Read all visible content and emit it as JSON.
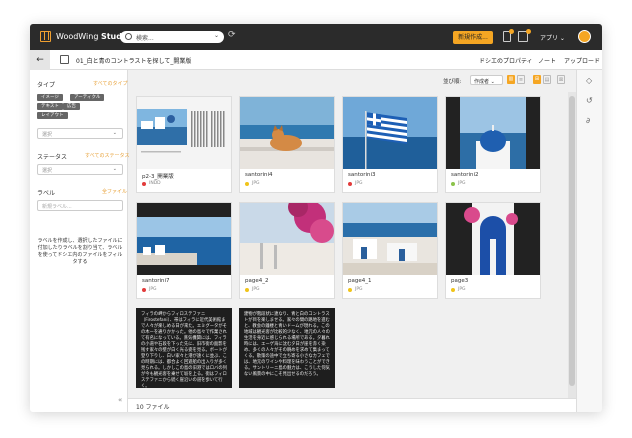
{
  "header": {
    "brand_name": "WoodWing",
    "brand_product": "Studio",
    "search_placeholder": "検索...",
    "new_button": "新規作成...",
    "apps_label": "アプリ ⌄",
    "refresh_icon": "refresh-icon"
  },
  "breadcrumb": {
    "path": "01_白と青のコントラストを探して_開業版",
    "actions": [
      "ドシエのプロパティ",
      "ノート",
      "アップロード"
    ]
  },
  "sidebar": {
    "type_heading": "タイプ",
    "type_link": "すべてのタイプ",
    "type_tags": [
      "イメージ",
      "テキスト",
      "テキスト",
      "レイアウト"
    ],
    "type_tags_row1": [
      "イメージ",
      "アーティクル"
    ],
    "type_tags_row2": [
      "テキスト",
      "広告"
    ],
    "type_tags_row3": [
      "レイアウト"
    ],
    "type_select_placeholder": "選択",
    "status_heading": "ステータス",
    "status_link": "すべてのステータス",
    "status_select_placeholder": "選択",
    "label_heading": "ラベル",
    "label_link": "全ファイル",
    "label_input_placeholder": "新規ラベル...",
    "help_text": "ラベルを作成し、選択したファイルに付加したりラベルを割り当て、ラベルを使ってドシエ内のファイルをフィルタする"
  },
  "toolbar": {
    "sort_label": "並び順:",
    "sort_value": "作成者",
    "view_buttons": [
      "▥",
      "≡",
      "⊞",
      "▤",
      "⊠"
    ]
  },
  "files": [
    {
      "name": "p2-3_開業版",
      "type": "INDD",
      "status_color": "#e23b3b",
      "thumb": "layout"
    },
    {
      "name": "santorini4",
      "type": "JPG",
      "status_color": "#f0c419",
      "thumb": "cat"
    },
    {
      "name": "santorini3",
      "type": "JPG",
      "status_color": "#e23b3b",
      "thumb": "flag"
    },
    {
      "name": "santorini2",
      "type": "JPG",
      "status_color": "#8bc34a",
      "thumb": "dome"
    },
    {
      "name": "santorini7",
      "type": "JPG",
      "status_color": "#e23b3b",
      "thumb": "sea"
    },
    {
      "name": "page4_2",
      "type": "JPG",
      "status_color": "#f0c419",
      "thumb": "flowers"
    },
    {
      "name": "page4_1",
      "type": "JPG",
      "status_color": "#f0c419",
      "thumb": "houses"
    },
    {
      "name": "page3",
      "type": "JPG",
      "status_color": "#f0c419",
      "thumb": "door"
    }
  ],
  "text_files": [
    {
      "text": "フィラの岬からフィロステファニ（Firostefani）、帯はフィラに近代美術館まで人々が楽しめる日が来た。エミグータがその木ーを通りかかった。他の島々で作業されて有名になっている。蒸気機関には、フィラの小道や石段を下った先に、旧市街の面影を残す家々の壁が白く光る姿を見る。ボートが登り下りし、白い家々と港が遠くに並ぶ、この時期には、都合よく回遊船の出入りが多く見られる。しかしこの島の旧港ではロバの列が今も観光客を乗せて坂を上る。街はフィロステファニから続く崖沿いの道を歩いて行く。",
      "title": "フィラからの..."
    },
    {
      "text": "建物が階段状に連なり、青と白のコントラストが目を楽しませる。家々の間の路地を進むと、教会の鐘楼と青いドームが現れる。この地域は観光客が比較的少なく、地元の人々の生活を身近に感じられる場所である。夕暮れ時には、エーゲ海に沈む夕日が崖を赤く染め、多くの人々がその眺めを求めて集まってくる。散策の途中で立ち寄る小さなカフェでは、地元のワインや料理を味わうことができる。サントリーニ島の魅力は、こうした何気ない風景の中にこそ見出せるのだろう。",
      "title": "ウィンドウ..."
    }
  ],
  "footer": {
    "count": "10 ファイル"
  }
}
